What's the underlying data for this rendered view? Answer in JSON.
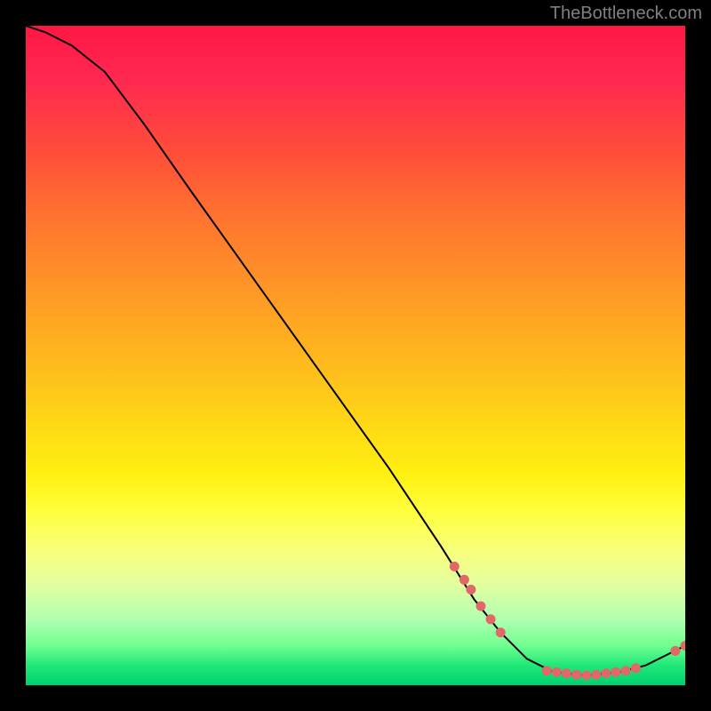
{
  "attribution": "TheBottleneck.com",
  "chart_data": {
    "type": "line",
    "title": "",
    "xlabel": "",
    "ylabel": "",
    "xlim": [
      0,
      100
    ],
    "ylim": [
      0,
      100
    ],
    "curve": [
      {
        "x": 0,
        "y": 100
      },
      {
        "x": 3,
        "y": 99
      },
      {
        "x": 7,
        "y": 97
      },
      {
        "x": 12,
        "y": 93
      },
      {
        "x": 18,
        "y": 85
      },
      {
        "x": 25,
        "y": 75
      },
      {
        "x": 35,
        "y": 61
      },
      {
        "x": 45,
        "y": 47
      },
      {
        "x": 55,
        "y": 33
      },
      {
        "x": 63,
        "y": 21
      },
      {
        "x": 68,
        "y": 13
      },
      {
        "x": 72,
        "y": 8
      },
      {
        "x": 76,
        "y": 4
      },
      {
        "x": 80,
        "y": 2
      },
      {
        "x": 85,
        "y": 1.5
      },
      {
        "x": 90,
        "y": 2
      },
      {
        "x": 94,
        "y": 3
      },
      {
        "x": 97,
        "y": 4.5
      },
      {
        "x": 100,
        "y": 6
      }
    ],
    "markers_left": [
      {
        "x": 65,
        "y": 18
      },
      {
        "x": 66.5,
        "y": 16
      },
      {
        "x": 67.5,
        "y": 14.5
      },
      {
        "x": 69,
        "y": 12
      },
      {
        "x": 70.5,
        "y": 10
      },
      {
        "x": 72,
        "y": 8
      }
    ],
    "markers_bottom": [
      {
        "x": 79,
        "y": 2.2
      },
      {
        "x": 80.5,
        "y": 2.0
      },
      {
        "x": 82,
        "y": 1.8
      },
      {
        "x": 83.5,
        "y": 1.6
      },
      {
        "x": 85,
        "y": 1.5
      },
      {
        "x": 86.5,
        "y": 1.6
      },
      {
        "x": 88,
        "y": 1.8
      },
      {
        "x": 89.5,
        "y": 2.0
      },
      {
        "x": 91,
        "y": 2.2
      },
      {
        "x": 92.5,
        "y": 2.6
      }
    ],
    "markers_right": [
      {
        "x": 98.5,
        "y": 5.2
      },
      {
        "x": 100,
        "y": 6.0
      }
    ],
    "marker_color": "#e06868",
    "curve_color": "#000000"
  }
}
